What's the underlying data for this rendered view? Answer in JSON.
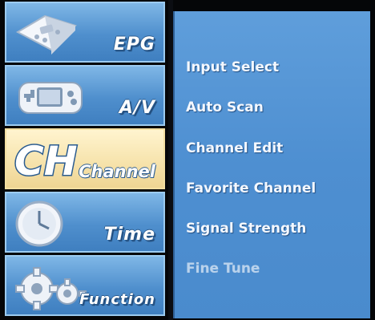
{
  "sidebar": {
    "items": [
      {
        "label": "EPG",
        "icon": "remote-control-icon",
        "active": false
      },
      {
        "label": "A/V",
        "icon": "game-controller-icon",
        "active": false
      },
      {
        "label": "Channel",
        "icon": "channel-ch-icon",
        "icon_text": "CH",
        "active": true
      },
      {
        "label": "Time",
        "icon": "clock-icon",
        "active": false
      },
      {
        "label": "Function",
        "icon": "gears-icon",
        "active": false
      }
    ]
  },
  "menu": {
    "items": [
      {
        "label": "Input Select",
        "enabled": true
      },
      {
        "label": "Auto Scan",
        "enabled": true
      },
      {
        "label": "Channel Edit",
        "enabled": true
      },
      {
        "label": "Favorite Channel",
        "enabled": true
      },
      {
        "label": "Signal Strength",
        "enabled": true
      },
      {
        "label": "Fine Tune",
        "enabled": false
      }
    ]
  },
  "colors": {
    "sidebar_blue": "#4f8fcd",
    "active_item": "#f6e2aa",
    "panel_blue": "#4e8fd1",
    "text": "#f4f8ff",
    "disabled_text": "#b9d2ec"
  }
}
